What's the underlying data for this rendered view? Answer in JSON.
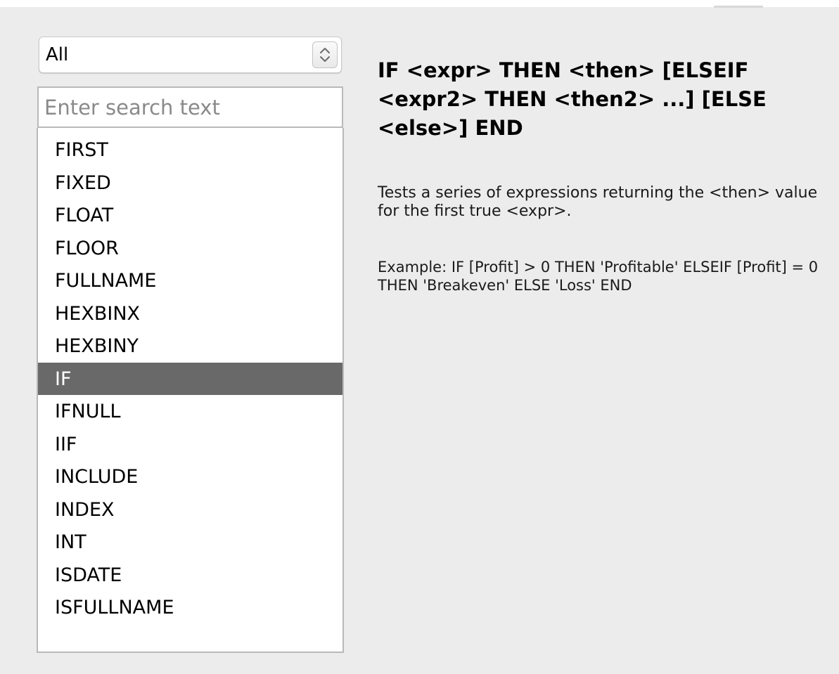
{
  "category_select": {
    "value": "All"
  },
  "search": {
    "placeholder": "Enter search text",
    "value": ""
  },
  "function_list": {
    "items": [
      {
        "label": "FIRST",
        "selected": false
      },
      {
        "label": "FIXED",
        "selected": false
      },
      {
        "label": "FLOAT",
        "selected": false
      },
      {
        "label": "FLOOR",
        "selected": false
      },
      {
        "label": "FULLNAME",
        "selected": false
      },
      {
        "label": "HEXBINX",
        "selected": false
      },
      {
        "label": "HEXBINY",
        "selected": false
      },
      {
        "label": "IF",
        "selected": true
      },
      {
        "label": "IFNULL",
        "selected": false
      },
      {
        "label": "IIF",
        "selected": false
      },
      {
        "label": "INCLUDE",
        "selected": false
      },
      {
        "label": "INDEX",
        "selected": false
      },
      {
        "label": "INT",
        "selected": false
      },
      {
        "label": "ISDATE",
        "selected": false
      },
      {
        "label": "ISFULLNAME",
        "selected": false
      }
    ]
  },
  "detail": {
    "syntax": "IF <expr> THEN <then> [ELSEIF <expr2> THEN <then2> ...] [ELSE <else>] END",
    "description": "Tests a series of expressions returning the <then> value for the first true <expr>.",
    "example": "Example: IF [Profit] > 0 THEN 'Profitable' ELSEIF [Profit] = 0 THEN 'Breakeven' ELSE 'Loss' END"
  },
  "colors": {
    "selected_row_bg": "#696969",
    "selected_row_text": "#ffffff",
    "panel_bg": "#ececec"
  },
  "icons": {
    "select_stepper": "up-down-chevron-icon"
  }
}
